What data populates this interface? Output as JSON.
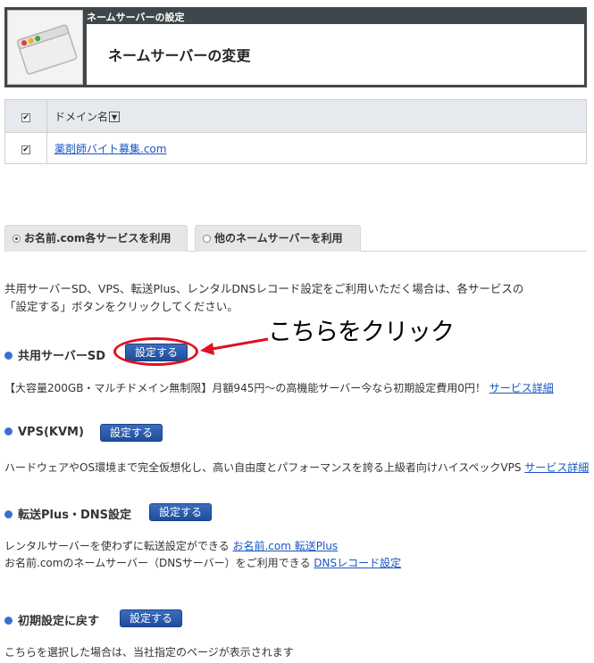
{
  "header": {
    "section_label": "ネームサーバーの設定",
    "title": "ネームサーバーの変更",
    "icon": "browser-window-icon"
  },
  "domain_table": {
    "column_header": "ドメイン名",
    "header_checkbox_checked": true,
    "rows": [
      {
        "checked": true,
        "domain": "薬剤師バイト募集.com"
      }
    ]
  },
  "tabs": [
    {
      "label": "お名前.com各サービスを利用",
      "selected": true
    },
    {
      "label": "他のネームサーバーを利用",
      "selected": false
    }
  ],
  "intro": {
    "line1": "共用サーバーSD、VPS、転送Plus、レンタルDNSレコード設定をご利用いただく場合は、各サービスの",
    "line2": "「設定する」ボタンをクリックしてください。"
  },
  "sections": [
    {
      "title": "共用サーバーSD",
      "button": "設定する",
      "desc": "【大容量200GB・マルチドメイン無制限】月額945円～の高機能サーバー今なら初期設定費用0円！",
      "link": "サービス詳細"
    },
    {
      "title": "VPS(KVM)",
      "button": "設定する",
      "desc": "ハードウェアやOS環境まで完全仮想化し、高い自由度とパフォーマンスを誇る上級者向けハイスペックVPS",
      "link": "サービス詳細"
    },
    {
      "title": "転送Plus・DNS設定",
      "button": "設定する",
      "desc1": "レンタルサーバーを使わずに転送設定ができる",
      "link1": "お名前.com 転送Plus",
      "desc2": "お名前.comのネームサーバー（DNSサーバー）をご利用できる",
      "link2": "DNSレコード設定"
    },
    {
      "title": "初期設定に戻す",
      "button": "設定する",
      "desc": "こちらを選択した場合は、当社指定のページが表示されます"
    }
  ],
  "annotation": {
    "text": "こちらをクリック",
    "color": "#e01020"
  },
  "colors": {
    "header_bg": "#40474b",
    "button_bg": "#2a5aa8",
    "bullet": "#3a6fd0",
    "link": "#1a56c4"
  }
}
